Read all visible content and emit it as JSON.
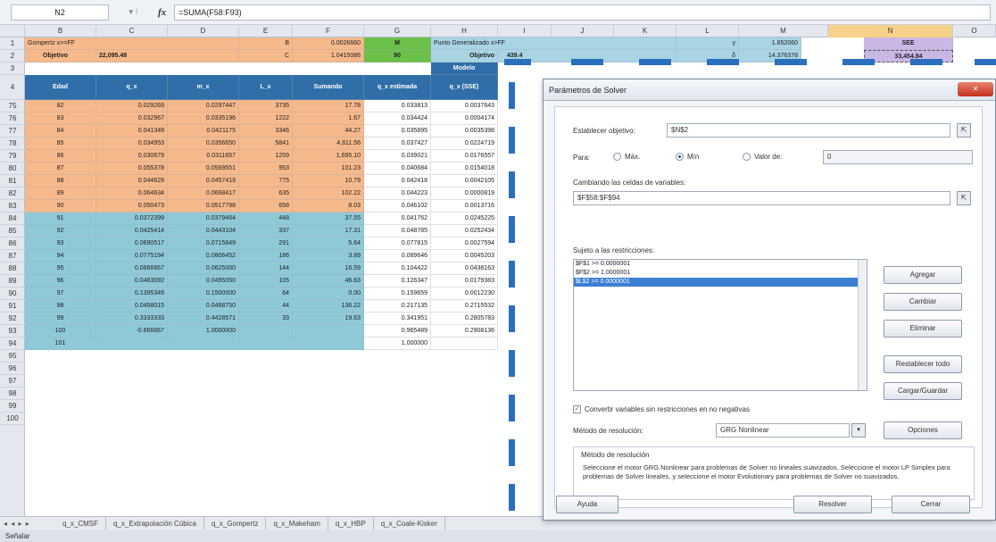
{
  "formula_bar": {
    "name_box": "N2",
    "arrows": "▾ ⁝",
    "fx": "fx",
    "formula": "=SUMA(F58:F93)"
  },
  "columns": [
    "",
    "B",
    "C",
    "D",
    "E",
    "F",
    "G",
    "H",
    "I",
    "J",
    "K",
    "L",
    "M",
    "N",
    "O"
  ],
  "rows": [
    "1",
    "2",
    "3",
    "4",
    "75",
    "76",
    "77",
    "78",
    "79",
    "80",
    "81",
    "82",
    "83",
    "84",
    "85",
    "86",
    "87",
    "88",
    "89",
    "90",
    "91",
    "92",
    "93",
    "94",
    "95",
    "96",
    "97",
    "98",
    "99",
    "100"
  ],
  "top_rows": {
    "r1": {
      "b": "Gompertz x>=FF",
      "e": "B",
      "f": "0.0026660",
      "g": "M",
      "h": "Punto Generalizado x>FF",
      "k": "γ",
      "l": "1.652060",
      "n": "SEE"
    },
    "r2": {
      "b": "Objetivo",
      "c": "22,095.48",
      "e": "C",
      "f": "1.0415086",
      "g": "90",
      "h": "Objetivo",
      "i": "439.4",
      "k": "δ",
      "l": "14.376378",
      "n": "33,454.84"
    },
    "r4": {
      "b": "Edad",
      "c": "q_x",
      "d": "m_x",
      "e": "L_x",
      "f": "Sumando",
      "g": "q_x estimada",
      "h_top": "Modelo",
      "h": "q_x (SSE)"
    }
  },
  "orange_rows": [
    [
      "82",
      "0.029269",
      "0.0297447",
      "3735",
      "17.78",
      "0.033813",
      "0.0037643"
    ],
    [
      "83",
      "0.032967",
      "0.0335196",
      "1222",
      "1.67",
      "0.034424",
      "0.0004174"
    ],
    [
      "84",
      "0.041349",
      "0.0421175",
      "3346",
      "44.27",
      "0.035895",
      "0.0035398"
    ],
    [
      "85",
      "0.034953",
      "0.0356650",
      "5841",
      "4,811.56",
      "0.037427",
      "0.0224719"
    ],
    [
      "86",
      "0.030679",
      "0.0311657",
      "1259",
      "1,695.10",
      "0.039021",
      "0.0176557"
    ],
    [
      "87",
      "0.055378",
      "0.0569551",
      "953",
      "101.23",
      "0.040684",
      "0.0154018"
    ],
    [
      "88",
      "0.044629",
      "0.0457419",
      "775",
      "10.79",
      "0.042418",
      "0.0042105"
    ],
    [
      "89",
      "0.064634",
      "0.0668417",
      "635",
      "102.22",
      "0.044223",
      "0.0000819"
    ],
    [
      "90",
      "0.050473",
      "0.0517798",
      "658",
      "8.03",
      "0.046102",
      "0.0013716"
    ]
  ],
  "blue_rows": [
    [
      "91",
      "0.0372399",
      "0.0379464",
      "448",
      "37.55",
      "0.041762",
      "0.0245225"
    ],
    [
      "92",
      "0.0425414",
      "0.0443104",
      "337",
      "17.31",
      "0.048785",
      "0.0252434"
    ],
    [
      "93",
      "0.0690517",
      "0.0715849",
      "291",
      "5.64",
      "0.077815",
      "0.0027594"
    ],
    [
      "94",
      "0.0775194",
      "0.0806452",
      "186",
      "3.89",
      "0.089646",
      "0.0045203"
    ],
    [
      "95",
      "0.0666667",
      "0.0625000",
      "144",
      "16.59",
      "0.104422",
      "0.0438163"
    ],
    [
      "96",
      "0.0483092",
      "0.0495050",
      "105",
      "46.63",
      "0.126347",
      "0.0179383"
    ],
    [
      "97",
      "0.1395349",
      "0.1500000",
      "64",
      "0.00",
      "0.159659",
      "0.0012230"
    ],
    [
      "98",
      "0.0458015",
      "0.0468750",
      "44",
      "136.22",
      "0.217135",
      "0.2715532"
    ],
    [
      "99",
      "0.3333333",
      "0.4428571",
      "33",
      "19.63",
      "0.341951",
      "0.2805783"
    ],
    [
      "100",
      "-0.666667",
      "1.0000000",
      "",
      "",
      "0.965489",
      "0.2908136"
    ],
    [
      "101",
      "",
      "",
      "",
      "",
      "1.000000",
      ""
    ]
  ],
  "sheet_tabs": [
    "q_x_CMSF",
    "q_x_Extrapolación Cúbica",
    "q_x_Gompertz",
    "q_x_Makeham",
    "q_x_HBP",
    "q_x_Coale-Kisker"
  ],
  "tab_nav": "◂ ◂ ▸ ▸",
  "status": "Señalar",
  "solver": {
    "title": "Parámetros de Solver",
    "close": "✕",
    "set_objective_label": "Establecer objetivo:",
    "set_objective_value": "$N$2",
    "to_label": "Para:",
    "opt_max": "Máx.",
    "opt_min": "Mín",
    "opt_value": "Valor de:",
    "value_of": "0",
    "by_changing_label": "Cambiando las celdas de variables:",
    "by_changing_value": "$F$58:$F$94",
    "ref_icon": "⇱",
    "constraints_label": "Sujeto a las restricciones:",
    "constraints": [
      "$F$1 >= 0.0000001",
      "$F$2 >= 1.0000001",
      "$L$2 >= 0.0000001"
    ],
    "btn_add": "Agregar",
    "btn_change": "Cambiar",
    "btn_delete": "Eliminar",
    "btn_reset": "Restablecer todo",
    "btn_load_save": "Cargar/Guardar",
    "checkbox_label": "Convertir variables sin restricciones en no negativas",
    "checkbox_mark": "✓",
    "method_label": "Método de resolución:",
    "method_value": "GRG Nonlinear",
    "method_arrow": "▾",
    "btn_options": "Opciones",
    "group_title": "Método de resolución",
    "description": "Seleccione el motor GRG Nonlinear para problemas de Solver no lineales suavizados. Seleccione el motor LP Simplex para problemas de Solver lineales, y seleccione el motor Evolutionary para problemas de Solver no suavizados.",
    "btn_help": "Ayuda",
    "btn_solve": "Resolver",
    "btn_close": "Cerrar"
  },
  "colors": {
    "orange": "#f6b98c",
    "blue": "#8fc9d8",
    "dark_blue": "#2f6ea8",
    "green": "#6cc04a",
    "lavender": "#cbb7e6",
    "dash": "#2a6fbd"
  }
}
